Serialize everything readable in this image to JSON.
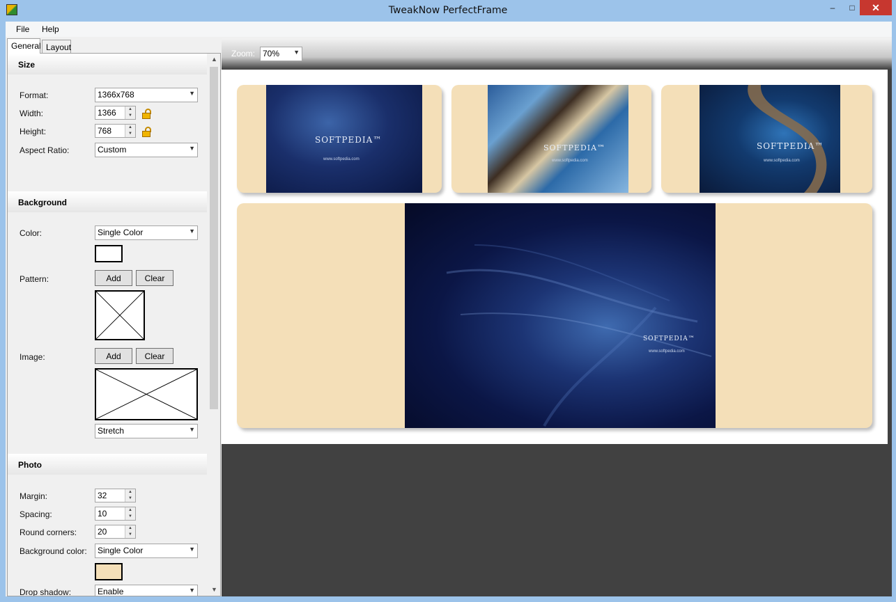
{
  "window": {
    "title": "TweakNow PerfectFrame",
    "minimize": "–",
    "maximize": "□",
    "close": "✕"
  },
  "menu": {
    "file": "File",
    "help": "Help"
  },
  "tabs": {
    "general": "General",
    "layout": "Layout"
  },
  "size": {
    "header": "Size",
    "format_label": "Format:",
    "format_value": "1366x768",
    "width_label": "Width:",
    "width_value": "1366",
    "height_label": "Height:",
    "height_value": "768",
    "aspect_label": "Aspect Ratio:",
    "aspect_value": "Custom"
  },
  "background": {
    "header": "Background",
    "color_label": "Color:",
    "color_value": "Single Color",
    "color_swatch": "#ffffff",
    "pattern_label": "Pattern:",
    "pattern_add": "Add",
    "pattern_clear": "Clear",
    "image_label": "Image:",
    "image_add": "Add",
    "image_clear": "Clear",
    "image_mode": "Stretch"
  },
  "photo": {
    "header": "Photo",
    "margin_label": "Margin:",
    "margin_value": "32",
    "spacing_label": "Spacing:",
    "spacing_value": "10",
    "round_label": "Round corners:",
    "round_value": "20",
    "bgcolor_label": "Background color:",
    "bgcolor_value": "Single Color",
    "bgcolor_swatch": "#f4dfb8",
    "shadow_label": "Drop shadow:",
    "shadow_value": "Enable"
  },
  "toolbar": {
    "zoom_label": "Zoom:",
    "zoom_value": "70%"
  },
  "preview": {
    "watermark": "SOFTPEDIA™",
    "url": "www.softpedia.com",
    "frame_color": "#f4dfb8"
  },
  "icons": {
    "lock": "lock-icon",
    "dropdown": "chevron-down-icon",
    "spin": "spin-arrows-icon",
    "placeholder": "empty-image-icon"
  }
}
